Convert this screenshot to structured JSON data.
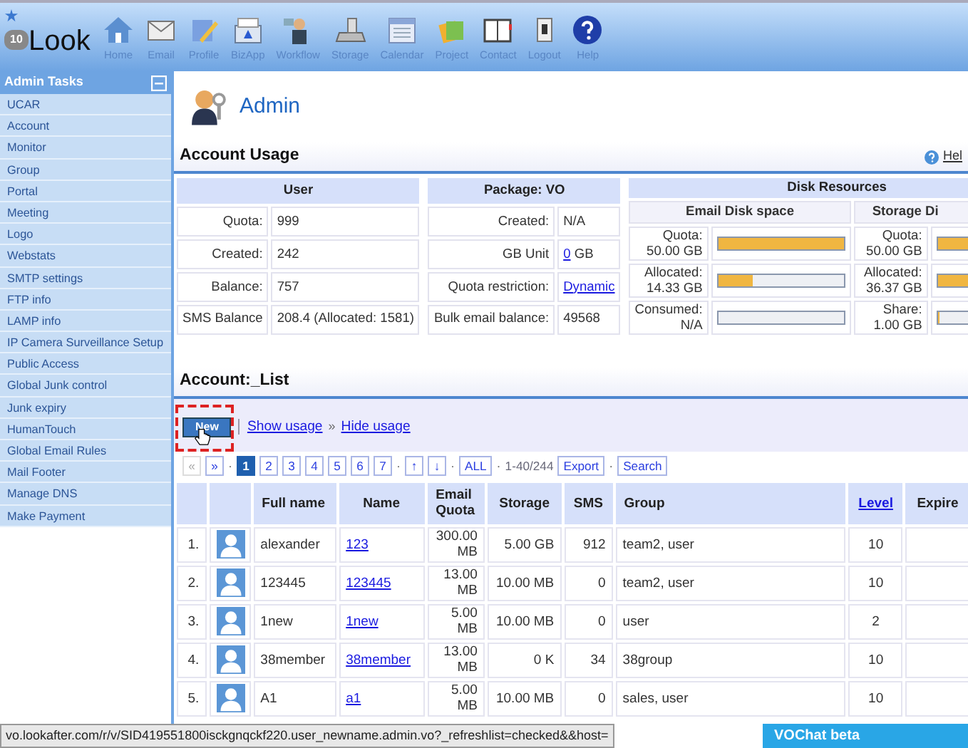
{
  "header": {
    "badge": "10",
    "logo": "Look"
  },
  "nav": [
    {
      "label": "Home"
    },
    {
      "label": "Email"
    },
    {
      "label": "Profile"
    },
    {
      "label": "BizApp"
    },
    {
      "label": "Workflow"
    },
    {
      "label": "Storage"
    },
    {
      "label": "Calendar"
    },
    {
      "label": "Project"
    },
    {
      "label": "Contact"
    },
    {
      "label": "Logout"
    },
    {
      "label": "Help"
    }
  ],
  "sidebar": {
    "title": "Admin Tasks",
    "items": [
      "UCAR",
      "Account",
      "Monitor",
      "Group",
      "Portal",
      "Meeting",
      "Logo",
      "Webstats",
      "SMTP settings",
      "FTP info",
      "LAMP info",
      "IP Camera Surveillance Setup",
      "Public Access",
      "Global Junk control",
      "Junk expiry",
      "HumanTouch",
      "Global Email Rules",
      "Mail Footer",
      "Manage DNS",
      "Make Payment"
    ]
  },
  "page_title": "Admin",
  "usage": {
    "title": "Account Usage",
    "help": "Hel",
    "user": {
      "header": "User",
      "rows": [
        {
          "label": "Quota:",
          "value": "999"
        },
        {
          "label": "Created:",
          "value": "242"
        },
        {
          "label": "Balance:",
          "value": "757"
        },
        {
          "label": "SMS Balance",
          "value": "208.4 (Allocated: 1581)"
        }
      ]
    },
    "package": {
      "header": "Package: VO",
      "rows": [
        {
          "label": "Created:",
          "value": "N/A",
          "kind": "text"
        },
        {
          "label": "GB Unit",
          "value": "0",
          "suffix": "GB",
          "kind": "link"
        },
        {
          "label": "Quota restriction:",
          "value": "Dynamic",
          "kind": "link"
        },
        {
          "label": "Bulk email balance:",
          "value": "49568",
          "kind": "text"
        }
      ]
    },
    "disk": {
      "header": "Disk Resources",
      "groups": [
        {
          "title": "Email Disk space",
          "meters": [
            {
              "label": "Quota:",
              "value": "50.00 GB",
              "level": 1
            },
            {
              "label": "Allocated:",
              "value": "14.33 GB",
              "level": 0.28
            },
            {
              "label": "Consumed:",
              "value": "N/A",
              "level": 0
            }
          ]
        },
        {
          "title": "Storage Di",
          "meters": [
            {
              "label": "Quota:",
              "value": "50.00 GB",
              "level": 1
            },
            {
              "label": "Allocated:",
              "value": "36.37 GB",
              "level": 0.73
            },
            {
              "label": "Share:",
              "value": "1.00 GB",
              "level": 0.02
            }
          ]
        }
      ]
    }
  },
  "list": {
    "title": "Account:_List",
    "toolbar": {
      "new_button": {
        "label": "New",
        "highlighted": true
      },
      "links": [
        {
          "label": "Show usage"
        },
        {
          "prefix": "»",
          "label": "Hide usage"
        }
      ]
    },
    "pager": [
      {
        "kind": "button",
        "label": "«",
        "disabled": true
      },
      {
        "kind": "button",
        "label": "»",
        "disabled": false
      },
      {
        "kind": "dot",
        "label": "·"
      },
      {
        "kind": "page",
        "label": "1",
        "selected": true
      },
      {
        "kind": "page",
        "label": "2",
        "selected": false
      },
      {
        "kind": "page",
        "label": "3",
        "selected": false
      },
      {
        "kind": "page",
        "label": "4",
        "selected": false
      },
      {
        "kind": "page",
        "label": "5",
        "selected": false
      },
      {
        "kind": "page",
        "label": "6",
        "selected": false
      },
      {
        "kind": "page",
        "label": "7",
        "selected": false
      },
      {
        "kind": "dot",
        "label": "·"
      },
      {
        "kind": "button",
        "label": "↑",
        "disabled": false
      },
      {
        "kind": "button",
        "label": "↓",
        "disabled": false
      },
      {
        "kind": "dot",
        "label": "·"
      },
      {
        "kind": "button",
        "label": "ALL",
        "disabled": false
      },
      {
        "kind": "dot",
        "label": "·"
      },
      {
        "kind": "text",
        "label": "1-40/244"
      },
      {
        "kind": "button",
        "label": "Export",
        "disabled": false
      },
      {
        "kind": "dot",
        "label": "·"
      },
      {
        "kind": "button",
        "label": "Search",
        "disabled": false
      }
    ],
    "columns": [
      {
        "kind": "index"
      },
      {
        "kind": "avatar"
      },
      {
        "kind": "text",
        "label": "Full name"
      },
      {
        "kind": "text",
        "label": "Name"
      },
      {
        "kind": "text",
        "label": "Email Quota"
      },
      {
        "kind": "text",
        "label": "Storage"
      },
      {
        "kind": "text",
        "label": "SMS"
      },
      {
        "kind": "text",
        "label": "Group"
      },
      {
        "kind": "link",
        "label": "Level"
      },
      {
        "kind": "text",
        "label": "Expire"
      }
    ],
    "rows": [
      {
        "index": "1.",
        "full_name": "alexander",
        "name": "123",
        "email_quota": "300.00 MB",
        "storage": "5.00 GB",
        "sms": "912",
        "group": "team2, user",
        "level": "10"
      },
      {
        "index": "2.",
        "full_name": "123445",
        "name": "123445",
        "email_quota": "13.00 MB",
        "storage": "10.00 MB",
        "sms": "0",
        "group": "team2, user",
        "level": "10"
      },
      {
        "index": "3.",
        "full_name": "1new",
        "name": "1new",
        "email_quota": "5.00 MB",
        "storage": "10.00 MB",
        "sms": "0",
        "group": "user",
        "level": "2"
      },
      {
        "index": "4.",
        "full_name": "38member",
        "name": "38member",
        "email_quota": "13.00 MB",
        "storage": "0 K",
        "sms": "34",
        "group": "38group",
        "level": "10"
      },
      {
        "index": "5.",
        "full_name": "A1",
        "name": "a1",
        "email_quota": "5.00 MB",
        "storage": "10.00 MB",
        "sms": "0",
        "group": "sales, user",
        "level": "10"
      }
    ]
  },
  "status_bar": "vo.lookafter.com/r/v/SID419551800isckgnqckf220.user_newname.admin.vo?_refreshlist=checked&&host=",
  "chat": "VOChat beta"
}
